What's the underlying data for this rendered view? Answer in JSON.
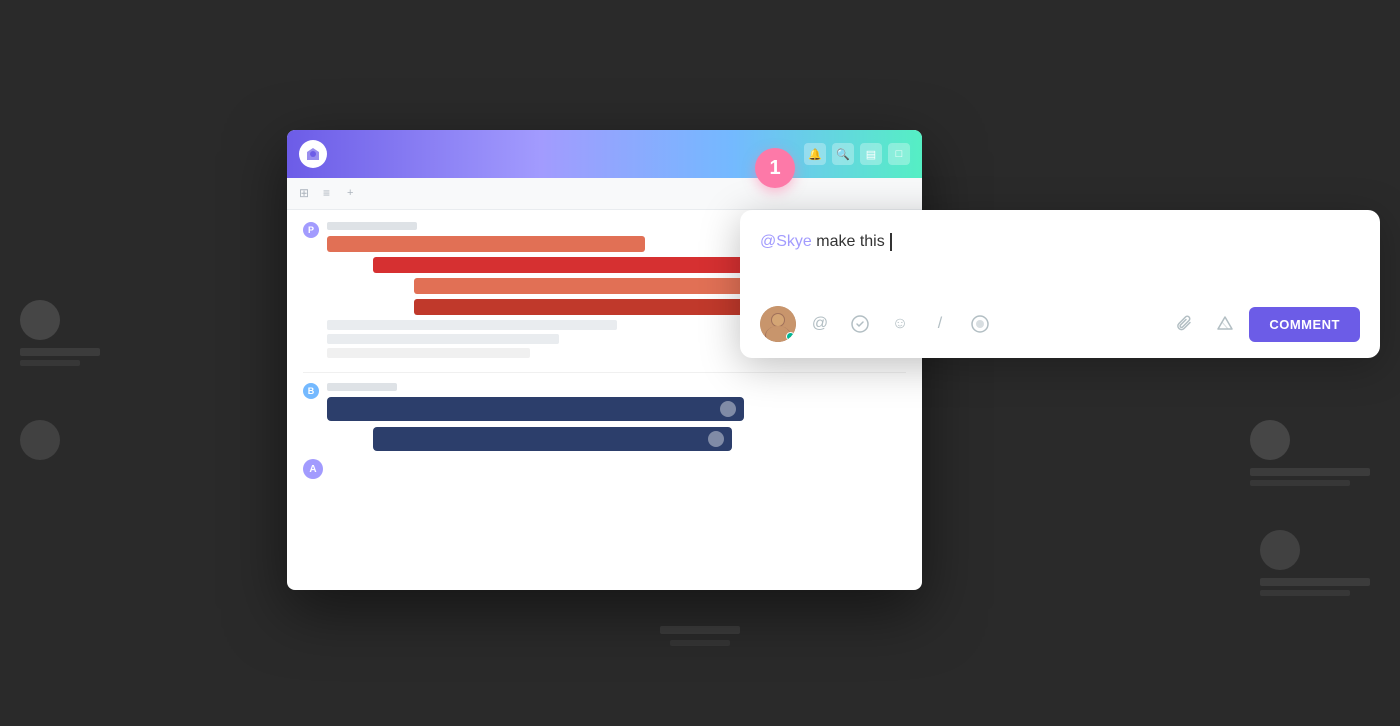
{
  "background": {
    "color": "#2d2d2d"
  },
  "notification_badge": {
    "number": "1",
    "color": "#fd79a8"
  },
  "app_card": {
    "header": {
      "logo": "☰",
      "icon1": "🔔",
      "icon2": "🔍",
      "icon3": "▤",
      "icon4": "⬜"
    },
    "toolbar": {
      "icon1": "⊞",
      "icon2": "≡"
    },
    "task_groups": [
      {
        "dot_color": "purple",
        "dot_label": "P",
        "bars": [
          {
            "color": "red",
            "width": "45%",
            "offset": "0%"
          },
          {
            "color": "dark-red",
            "width": "65%",
            "offset": "5%"
          },
          {
            "color": "red",
            "width": "55%",
            "offset": "12%"
          },
          {
            "color": "dark-red",
            "width": "58%",
            "offset": "12%"
          }
        ]
      },
      {
        "dot_color": "blue",
        "dot_label": "B",
        "bars": [
          {
            "color": "navy",
            "width": "70%",
            "offset": "0%"
          },
          {
            "color": "navy",
            "width": "60%",
            "offset": "5%"
          }
        ]
      }
    ],
    "bottom_avatar": "A"
  },
  "comment_popup": {
    "mention": "@Skye",
    "text": " make this ",
    "cursor": true,
    "toolbar": {
      "at_icon": "@",
      "clickup_icon": "⊙",
      "emoji_icon": "☺",
      "slash_icon": "/",
      "circle_icon": "◎",
      "attach_icon": "📎",
      "drive_icon": "▲",
      "submit_label": "COMMENT"
    }
  }
}
